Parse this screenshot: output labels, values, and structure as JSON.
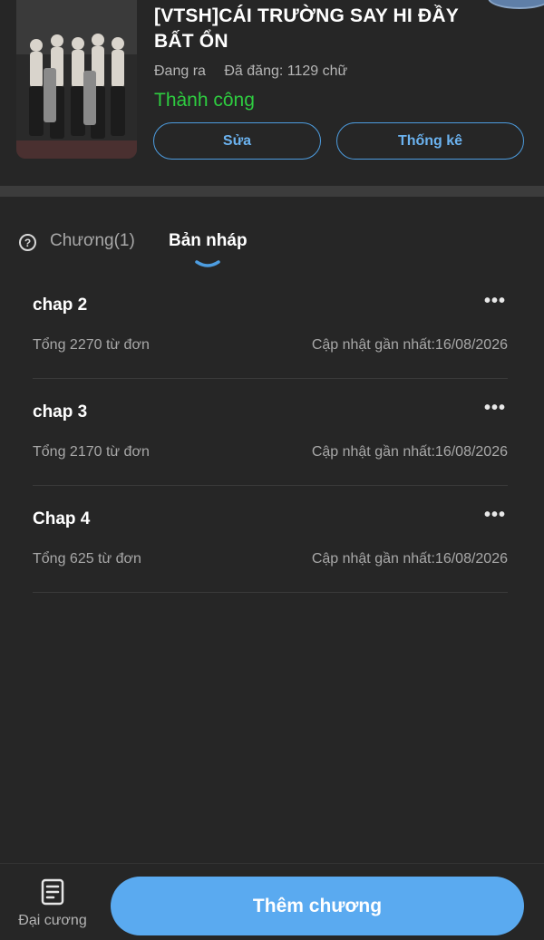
{
  "story": {
    "title": "[VTSH]CÁI TRƯỜNG SAY HI ĐẦY BẤT ỔN",
    "status_label": "Đang ra",
    "posted_label": "Đã đăng: 1129 chữ",
    "result": "Thành công",
    "cover_icon": "group-photo-cover"
  },
  "actions": {
    "edit_label": "Sửa",
    "stats_label": "Thống kê"
  },
  "tabs": {
    "help_icon": "question-circle-icon",
    "chapters_label": "Chương(1)",
    "drafts_label": "Bản nháp",
    "active": "drafts"
  },
  "drafts": [
    {
      "title": "chap 2",
      "words": "Tổng 2270 từ đơn",
      "updated": "Cập nhật gần nhất:16/08/2026"
    },
    {
      "title": "chap 3",
      "words": "Tổng 2170 từ đơn",
      "updated": "Cập nhật gần nhất:16/08/2026"
    },
    {
      "title": "Chap 4",
      "words": "Tổng 625 từ đơn",
      "updated": "Cập nhật gần nhất:16/08/2026"
    }
  ],
  "more_label": "•••",
  "bottom": {
    "outline_label": "Đại cương",
    "outline_icon": "document-icon",
    "add_chapter_label": "Thêm chương"
  },
  "colors": {
    "background": "#262626",
    "accent": "#5aaaf0",
    "success": "#2ecc40"
  }
}
